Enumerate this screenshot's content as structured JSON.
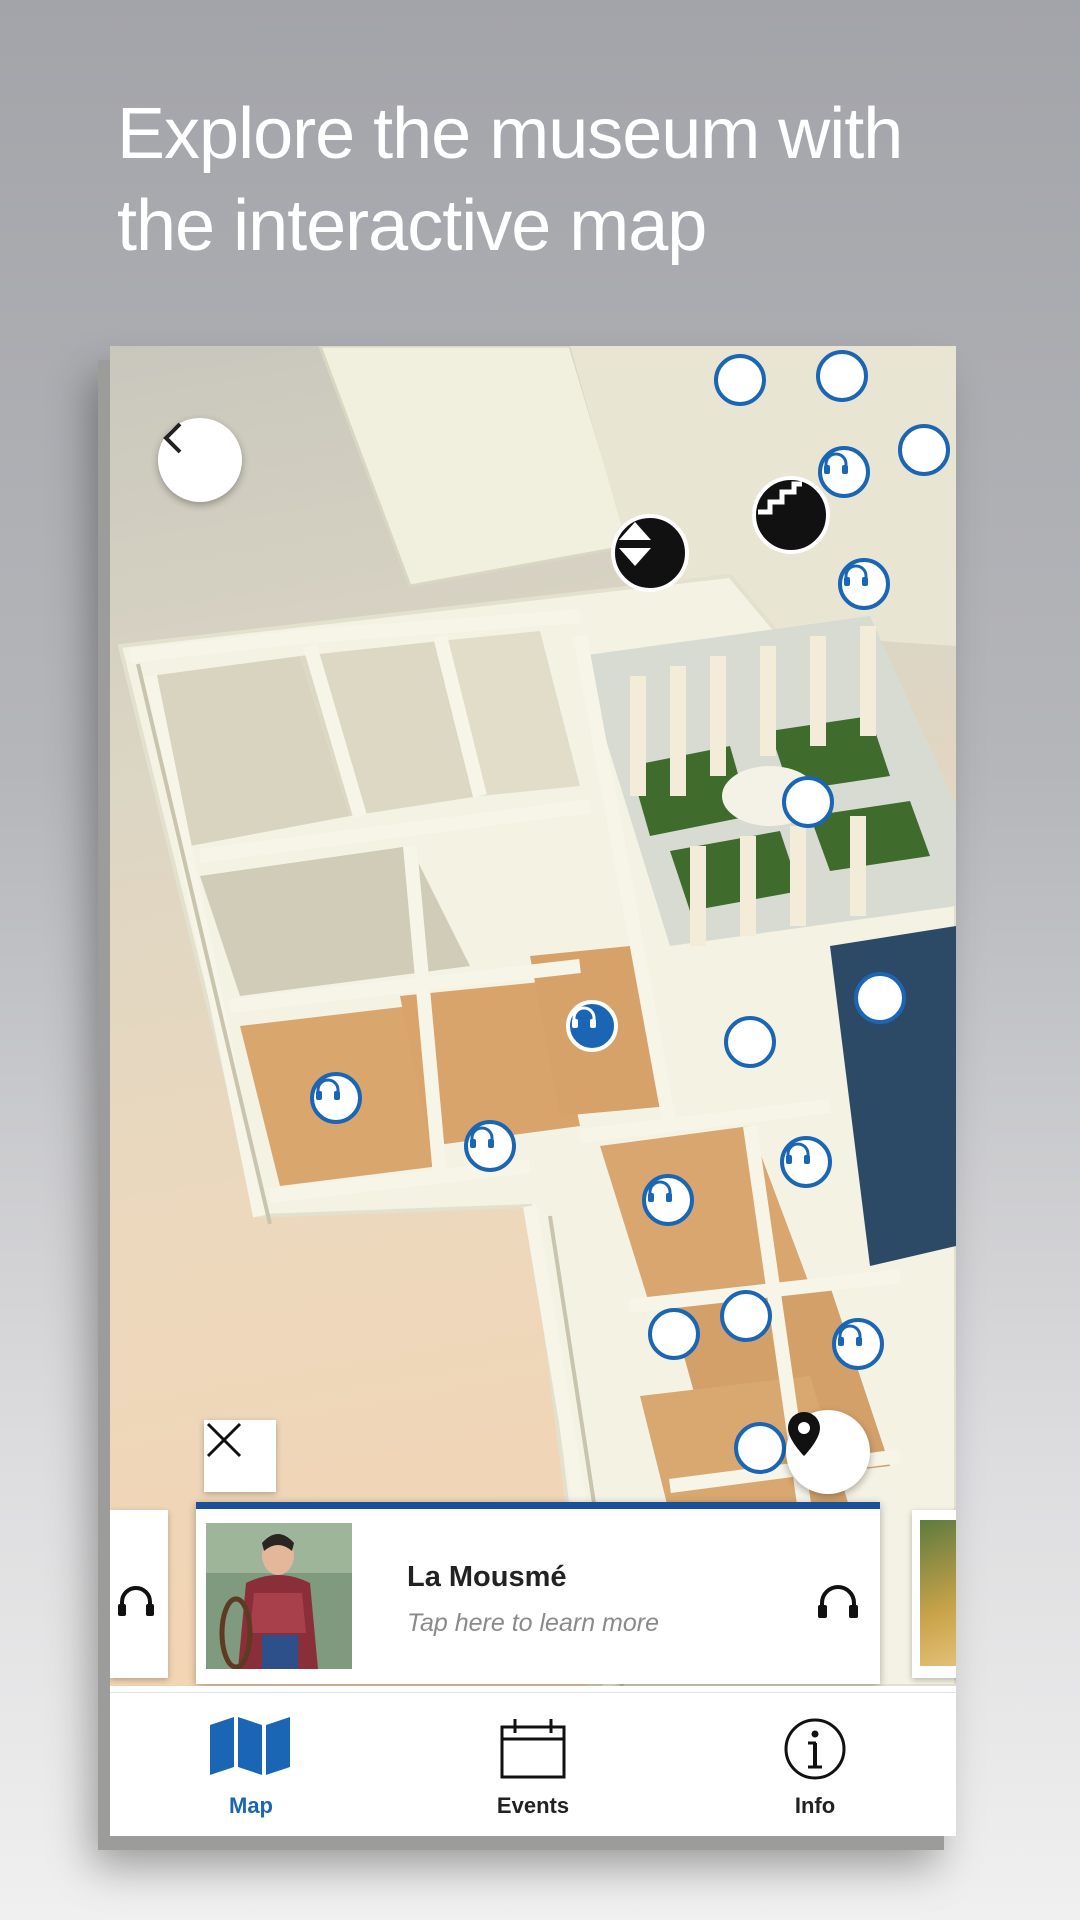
{
  "headline": {
    "line1": "Explore the museum with",
    "line2": "the interactive map"
  },
  "map": {
    "back_icon": "chevron-left-icon",
    "floor_icon": "floor-switch-icon",
    "stairs_icon": "stairs-icon",
    "location_icon": "map-pin-icon",
    "close_icon": "close-icon",
    "poi_icon": "headphones-icon"
  },
  "card": {
    "title": "La Mousmé",
    "subtitle": "Tap here to learn more",
    "audio_icon": "headphones-icon"
  },
  "tabs": [
    {
      "label": "Map",
      "icon": "map-icon",
      "active": true
    },
    {
      "label": "Events",
      "icon": "calendar-icon",
      "active": false
    },
    {
      "label": "Info",
      "icon": "info-icon",
      "active": false
    }
  ],
  "colors": {
    "accent": "#1a66b5",
    "card_border": "#1a4f99",
    "headline": "#ffffff"
  }
}
